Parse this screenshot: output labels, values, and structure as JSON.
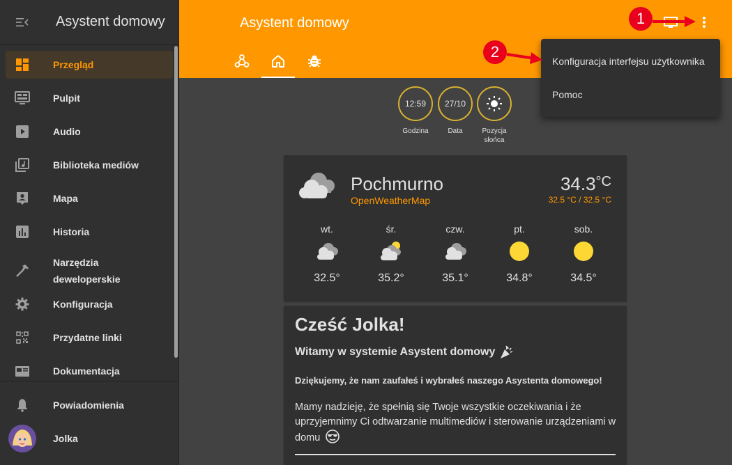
{
  "sidebar": {
    "title": "Asystent domowy",
    "items": [
      {
        "label": "Przegląd",
        "icon": "dashboard-icon"
      },
      {
        "label": "Pulpit",
        "icon": "monitor-icon"
      },
      {
        "label": "Audio",
        "icon": "play-icon"
      },
      {
        "label": "Biblioteka mediów",
        "icon": "media-library-icon"
      },
      {
        "label": "Mapa",
        "icon": "map-account-icon"
      },
      {
        "label": "Historia",
        "icon": "chart-bar-icon"
      },
      {
        "label": "Narzędzia",
        "label2": "deweloperskie",
        "icon": "hammer-icon"
      },
      {
        "label": "Konfiguracja",
        "icon": "gear-icon"
      },
      {
        "label": "Przydatne linki",
        "icon": "qrcode-icon"
      },
      {
        "label": "Dokumentacja",
        "icon": "newspaper-icon"
      }
    ],
    "notifications": "Powiadomienia",
    "user": "Jolka"
  },
  "header": {
    "title": "Asystent domowy"
  },
  "badges": [
    {
      "value": "12:59",
      "label": "Godzina"
    },
    {
      "value": "27/10",
      "label": "Data"
    },
    {
      "value": "",
      "label": "Pozycja",
      "label2": "słońca"
    }
  ],
  "weather": {
    "condition": "Pochmurno",
    "source": "OpenWeatherMap",
    "temp": "34.3",
    "unit": "°C",
    "range": "32.5 °C / 32.5 °C",
    "forecast": [
      {
        "day": "wt.",
        "temp": "32.5°",
        "icon": "cloudy-icon"
      },
      {
        "day": "śr.",
        "temp": "35.2°",
        "icon": "partly-cloudy-icon"
      },
      {
        "day": "czw.",
        "temp": "35.1°",
        "icon": "cloudy-icon"
      },
      {
        "day": "pt.",
        "temp": "34.8°",
        "icon": "sunny-icon"
      },
      {
        "day": "sob.",
        "temp": "34.5°",
        "icon": "sunny-icon"
      }
    ]
  },
  "welcome": {
    "heading": "Cześć Jolka!",
    "subheading": "Witamy w systemie Asystent domowy",
    "bold": "Dziękujemy, że nam zaufałeś i wybrałeś naszego Asystenta domowego!",
    "paragraph": "Mamy nadzieję, że spełnią się Twoje wszystkie oczekiwania i że uprzyjemnimy Ci odtwarzanie multimediów i sterowanie urządzeniami w domu"
  },
  "menu": {
    "items": [
      "Konfiguracja interfejsu użytkownika",
      "Pomoc"
    ]
  },
  "annotations": [
    "1",
    "2"
  ],
  "colors": {
    "accent": "#ff9800",
    "annotation": "#e8001c",
    "badge_border": "#d7b230"
  }
}
